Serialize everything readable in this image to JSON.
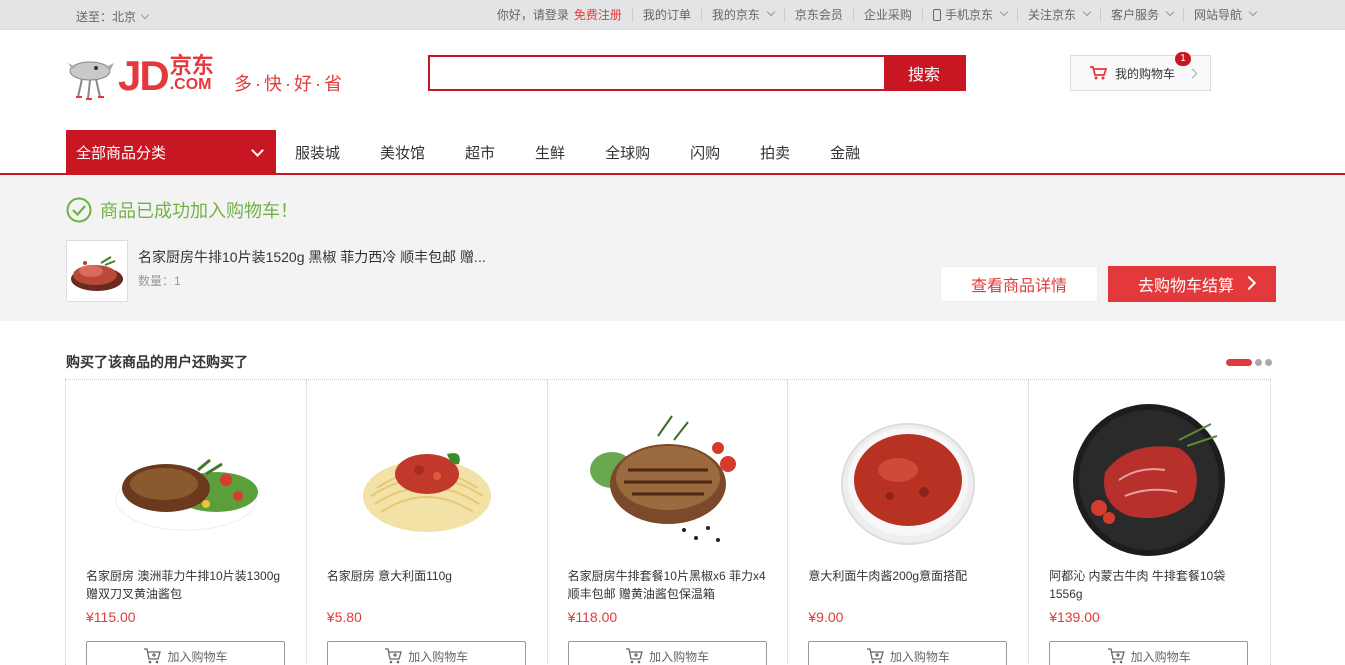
{
  "topbar": {
    "location": "送至：北京",
    "greeting": "你好，请登录",
    "register": "免费注册",
    "links": [
      "我的订单",
      "我的京东",
      "京东会员",
      "企业采购",
      "手机京东",
      "关注京东",
      "客户服务",
      "网站导航"
    ]
  },
  "header": {
    "logo_text": "JD",
    "logo_cn_top": "京东",
    "logo_cn_bottom": ".COM",
    "slogan": "多·快·好·省",
    "search_placeholder": "",
    "search_button": "搜索",
    "cart_label": "我的购物车",
    "cart_count": "1"
  },
  "nav": {
    "all_categories": "全部商品分类",
    "links": [
      "服装城",
      "美妆馆",
      "超市",
      "生鲜",
      "全球购",
      "闪购",
      "拍卖",
      "金融"
    ]
  },
  "success": {
    "message": "商品已成功加入购物车！",
    "product_name": "名家厨房牛排10片装1520g 黑椒 菲力西冷 顺丰包邮 赠...",
    "quantity": "数量：1",
    "detail_button": "查看商品详情",
    "checkout_button": "去购物车结算"
  },
  "recommend": {
    "title": "购买了该商品的用户还购买了",
    "add_label": "加入购物车",
    "items": [
      {
        "name": "名家厨房 澳洲菲力牛排10片装1300g 赠双刀叉黄油酱包",
        "price": "¥115.00"
      },
      {
        "name": "名家厨房 意大利面110g",
        "price": "¥5.80"
      },
      {
        "name": "名家厨房牛排套餐10片黑椒x6 菲力x4 顺丰包邮 赠黄油酱包保温箱",
        "price": "¥118.00"
      },
      {
        "name": "意大利面牛肉酱200g意面搭配",
        "price": "¥9.00"
      },
      {
        "name": "阿都沁 内蒙古牛肉 牛排套餐10袋1556g",
        "price": "¥139.00"
      }
    ]
  },
  "colors": {
    "brand_red": "#e4393c",
    "dark_red": "#c81623",
    "success_green": "#71b247"
  }
}
